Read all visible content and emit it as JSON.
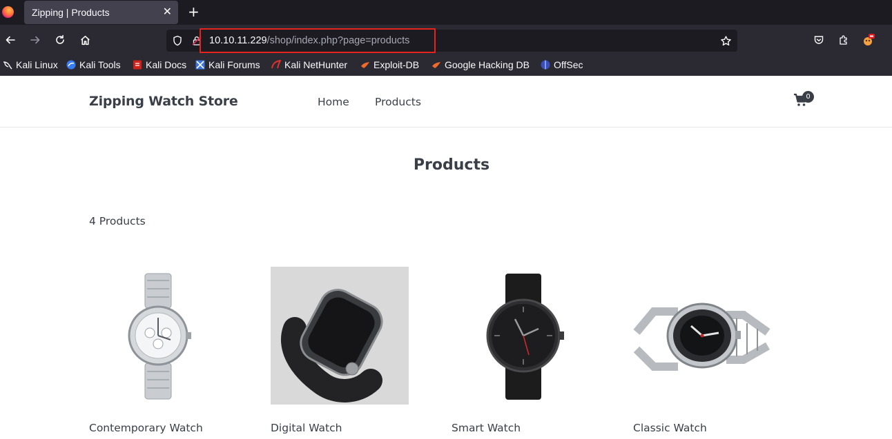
{
  "browser": {
    "tab_title": "Zipping | Products",
    "tab_close": "✕",
    "new_tab": "+",
    "url_host": "10.10.11.229",
    "url_path": "/shop/index.php?page=products",
    "bookmarks": [
      {
        "label": "Kali Linux",
        "icon": "kali-dragon-icon"
      },
      {
        "label": "Kali Tools",
        "icon": "kali-tools-icon"
      },
      {
        "label": "Kali Docs",
        "icon": "kali-docs-icon"
      },
      {
        "label": "Kali Forums",
        "icon": "kali-forums-icon"
      },
      {
        "label": "Kali NetHunter",
        "icon": "nethunter-icon"
      },
      {
        "label": "Exploit-DB",
        "icon": "exploit-db-icon"
      },
      {
        "label": "Google Hacking DB",
        "icon": "ghdb-icon"
      },
      {
        "label": "OffSec",
        "icon": "offsec-icon"
      }
    ]
  },
  "site": {
    "brand": "Zipping Watch Store",
    "nav": [
      {
        "label": "Home"
      },
      {
        "label": "Products"
      }
    ],
    "cart_count": "0",
    "cart_icon": "shopping-cart-icon"
  },
  "main": {
    "heading": "Products",
    "count_text": "4 Products",
    "products": [
      {
        "name": "Contemporary Watch",
        "image": "silver-chronograph-watch-image"
      },
      {
        "name": "Digital Watch",
        "image": "black-smartwatch-image"
      },
      {
        "name": "Smart Watch",
        "image": "black-leather-watch-image"
      },
      {
        "name": "Classic Watch",
        "image": "steel-diver-watch-image"
      }
    ]
  },
  "colors": {
    "chrome_dark": "#1c1b22",
    "chrome": "#2b2a33",
    "tab_active": "#42414d",
    "highlight_box": "#e8231d",
    "site_text": "#3a3f47"
  }
}
